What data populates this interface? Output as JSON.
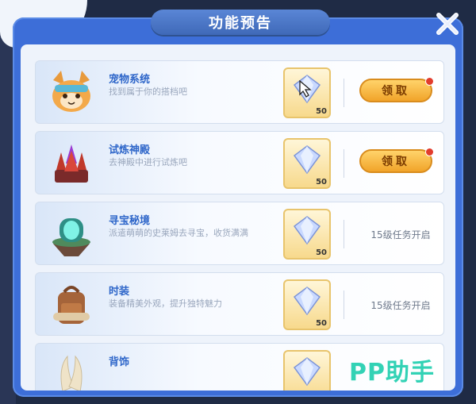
{
  "dialog": {
    "title": "功能预告",
    "close_icon": "close-x-icon"
  },
  "features": [
    {
      "name": "宠物系统",
      "desc": "找到属于你的搭档吧",
      "icon": "cat-pet-icon",
      "reward_icon": "diamond-icon",
      "reward_count": "50",
      "action": "领取",
      "state": "claimable"
    },
    {
      "name": "试炼神殿",
      "desc": "去神殿中进行试炼吧",
      "icon": "crystal-temple-icon",
      "reward_icon": "diamond-icon",
      "reward_count": "50",
      "action": "领取",
      "state": "claimable"
    },
    {
      "name": "寻宝秘境",
      "desc": "派遣萌萌的史莱姆去寻宝，收货满满",
      "icon": "portal-island-icon",
      "reward_icon": "diamond-icon",
      "reward_count": "50",
      "action": "15级任务开启",
      "state": "locked"
    },
    {
      "name": "时装",
      "desc": "装备精美外观，提升独特魅力",
      "icon": "backpack-icon",
      "reward_icon": "diamond-icon",
      "reward_count": "50",
      "action": "15级任务开启",
      "state": "locked"
    },
    {
      "name": "背饰",
      "desc": "",
      "icon": "wing-icon",
      "reward_icon": "diamond-icon",
      "reward_count": "",
      "action": "",
      "state": "partial"
    }
  ],
  "watermark": "PP助手",
  "colors": {
    "accent": "#2e66c9",
    "panel": "#3d6ed8",
    "claim": "#f1a42a"
  }
}
